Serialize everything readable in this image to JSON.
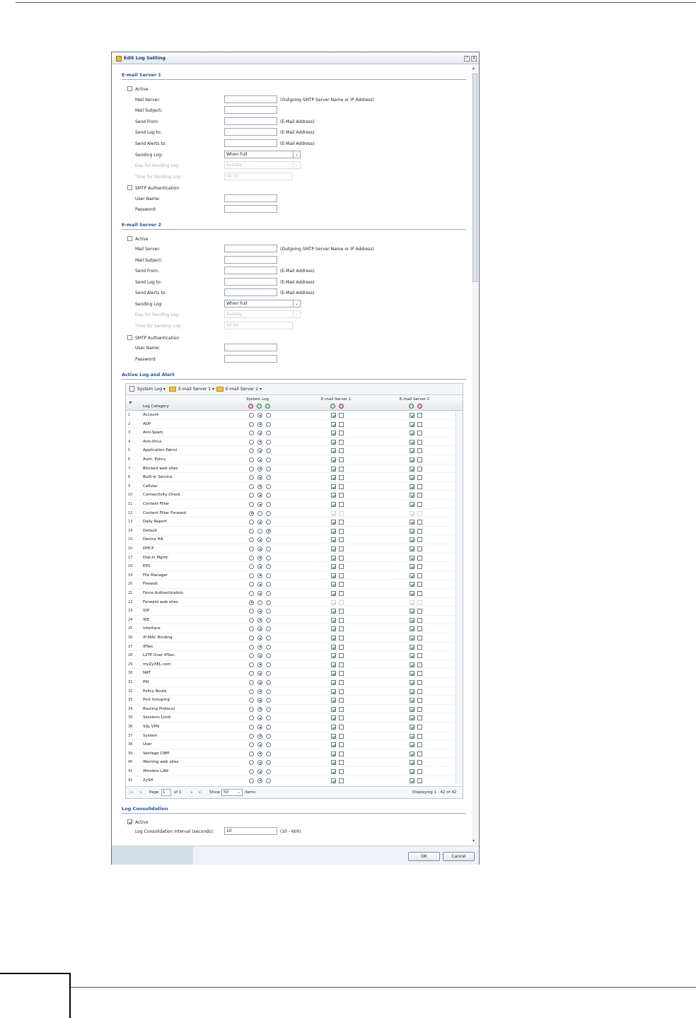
{
  "dialog": {
    "title": "Edit Log Setting",
    "help": "?",
    "close": "X",
    "ok": "OK",
    "cancel": "Cancel"
  },
  "server1": {
    "title": "E-mail Server 1",
    "active": "Active",
    "mail_server": "Mail Server:",
    "mail_server_hint": "(Outgoing SMTP Server Name or IP Address)",
    "mail_subject": "Mail Subject:",
    "send_from": "Send From:",
    "send_log_to": "Send Log to:",
    "send_alerts_to": "Send Alerts to:",
    "email_hint": "(E-Mail Address)",
    "sending_log": "Sending Log:",
    "sending_log_value": "When Full",
    "day_label": "Day for Sending Log:",
    "day_value": "Sunday",
    "time_label": "Time for Sending Log:",
    "time_value": "00:00",
    "smtp_auth": "SMTP Authentication",
    "user_name": "User Name:",
    "password": "Password:"
  },
  "server2": {
    "title": "E-mail Server 2",
    "active": "Active",
    "mail_server": "Mail Server:",
    "mail_server_hint": "(Outgoing SMTP Server Name or IP Address)",
    "mail_subject": "Mail Subject:",
    "send_from": "Send From:",
    "send_log_to": "Send Log to:",
    "send_alerts_to": "Send Alerts to:",
    "email_hint": "(E-Mail Address)",
    "sending_log": "Sending Log:",
    "sending_log_value": "When Full",
    "day_label": "Day for Sending Log:",
    "day_value": "Sunday",
    "time_label": "Time for Sending Log:",
    "time_value": "00:00",
    "smtp_auth": "SMTP Authentication",
    "user_name": "User Name:",
    "password": "Password:"
  },
  "alerts": {
    "title": "Active Log and Alert",
    "toolbar": {
      "system_log": "System Log",
      "email1": "E-mail Server 1",
      "email2": "E-mail Server 2"
    },
    "headers": {
      "num": "#",
      "category": "Log Category",
      "system_log": "System Log",
      "email1": "E-mail Server 1",
      "email2": "E-mail Server 2"
    },
    "rows": [
      {
        "n": "1",
        "c": "Account",
        "s": 1,
        "e1": 1,
        "e2": 1
      },
      {
        "n": "2",
        "c": "ADP",
        "s": 1,
        "e1": 1,
        "e2": 1
      },
      {
        "n": "3",
        "c": "Anti-Spam",
        "s": 1,
        "e1": 1,
        "e2": 1
      },
      {
        "n": "4",
        "c": "Anti-Virus",
        "s": 1,
        "e1": 1,
        "e2": 1
      },
      {
        "n": "5",
        "c": "Application Patrol",
        "s": 1,
        "e1": 1,
        "e2": 1
      },
      {
        "n": "6",
        "c": "Auth. Policy",
        "s": 1,
        "e1": 1,
        "e2": 1
      },
      {
        "n": "7",
        "c": "Blocked web sites",
        "s": 1,
        "e1": 1,
        "e2": 1
      },
      {
        "n": "8",
        "c": "Built-in Service",
        "s": 1,
        "e1": 1,
        "e2": 1
      },
      {
        "n": "9",
        "c": "Cellular",
        "s": 1,
        "e1": 1,
        "e2": 1
      },
      {
        "n": "10",
        "c": "Connectivity Check",
        "s": 1,
        "e1": 1,
        "e2": 1
      },
      {
        "n": "11",
        "c": "Content Filter",
        "s": 1,
        "e1": 1,
        "e2": 1
      },
      {
        "n": "12",
        "c": "Content Filter Forward",
        "s": 0,
        "e1": 0,
        "e2": 0
      },
      {
        "n": "13",
        "c": "Daily Report",
        "s": 1,
        "e1": 1,
        "e2": 1
      },
      {
        "n": "14",
        "c": "Default",
        "s": 2,
        "e1": 1,
        "e2": 1
      },
      {
        "n": "15",
        "c": "Device HA",
        "s": 1,
        "e1": 1,
        "e2": 1
      },
      {
        "n": "16",
        "c": "DHCP",
        "s": 1,
        "e1": 1,
        "e2": 1
      },
      {
        "n": "17",
        "c": "Dial-in Mgmt.",
        "s": 1,
        "e1": 1,
        "e2": 1
      },
      {
        "n": "18",
        "c": "EPS",
        "s": 1,
        "e1": 1,
        "e2": 1
      },
      {
        "n": "19",
        "c": "File Manager",
        "s": 1,
        "e1": 1,
        "e2": 1
      },
      {
        "n": "20",
        "c": "Firewall",
        "s": 1,
        "e1": 1,
        "e2": 1
      },
      {
        "n": "21",
        "c": "Force Authentication",
        "s": 1,
        "e1": 1,
        "e2": 1
      },
      {
        "n": "22",
        "c": "Forward web sites",
        "s": 0,
        "e1": 0,
        "e2": 0
      },
      {
        "n": "23",
        "c": "IDP",
        "s": 1,
        "e1": 1,
        "e2": 1
      },
      {
        "n": "24",
        "c": "IKE",
        "s": 1,
        "e1": 1,
        "e2": 1
      },
      {
        "n": "25",
        "c": "Interface",
        "s": 1,
        "e1": 1,
        "e2": 1
      },
      {
        "n": "26",
        "c": "IP-MAC Binding",
        "s": 1,
        "e1": 1,
        "e2": 1
      },
      {
        "n": "27",
        "c": "IPSec",
        "s": 1,
        "e1": 1,
        "e2": 1
      },
      {
        "n": "28",
        "c": "L2TP Over IPSec",
        "s": 1,
        "e1": 1,
        "e2": 1
      },
      {
        "n": "29",
        "c": "myZyXEL.com",
        "s": 1,
        "e1": 1,
        "e2": 1
      },
      {
        "n": "30",
        "c": "NAT",
        "s": 1,
        "e1": 1,
        "e2": 1
      },
      {
        "n": "31",
        "c": "PKI",
        "s": 1,
        "e1": 1,
        "e2": 1
      },
      {
        "n": "32",
        "c": "Policy Route",
        "s": 1,
        "e1": 1,
        "e2": 1
      },
      {
        "n": "33",
        "c": "Port Grouping",
        "s": 1,
        "e1": 1,
        "e2": 1
      },
      {
        "n": "34",
        "c": "Routing Protocol",
        "s": 1,
        "e1": 1,
        "e2": 1
      },
      {
        "n": "35",
        "c": "Sessions Limit",
        "s": 1,
        "e1": 1,
        "e2": 1
      },
      {
        "n": "36",
        "c": "SSL VPN",
        "s": 1,
        "e1": 1,
        "e2": 1
      },
      {
        "n": "37",
        "c": "System",
        "s": 1,
        "e1": 1,
        "e2": 1
      },
      {
        "n": "38",
        "c": "User",
        "s": 1,
        "e1": 1,
        "e2": 1
      },
      {
        "n": "39",
        "c": "Vantage CNM",
        "s": 1,
        "e1": 1,
        "e2": 1
      },
      {
        "n": "40",
        "c": "Warning web sites",
        "s": 1,
        "e1": 1,
        "e2": 1
      },
      {
        "n": "41",
        "c": "Wireless LAN",
        "s": 1,
        "e1": 1,
        "e2": 1
      },
      {
        "n": "42",
        "c": "ZySH",
        "s": 1,
        "e1": 1,
        "e2": 1
      }
    ],
    "pager": {
      "page_label": "Page",
      "page_value": "1",
      "of": "of 1",
      "show": "Show",
      "show_value": "50",
      "items": "items",
      "displaying": "Displaying 1 - 42 of 42"
    }
  },
  "consolidation": {
    "title": "Log Consolidation",
    "active": "Active",
    "interval_label": "Log Consolidation Interval (seconds):",
    "interval_value": "10",
    "interval_hint": "(10 - 600)"
  }
}
